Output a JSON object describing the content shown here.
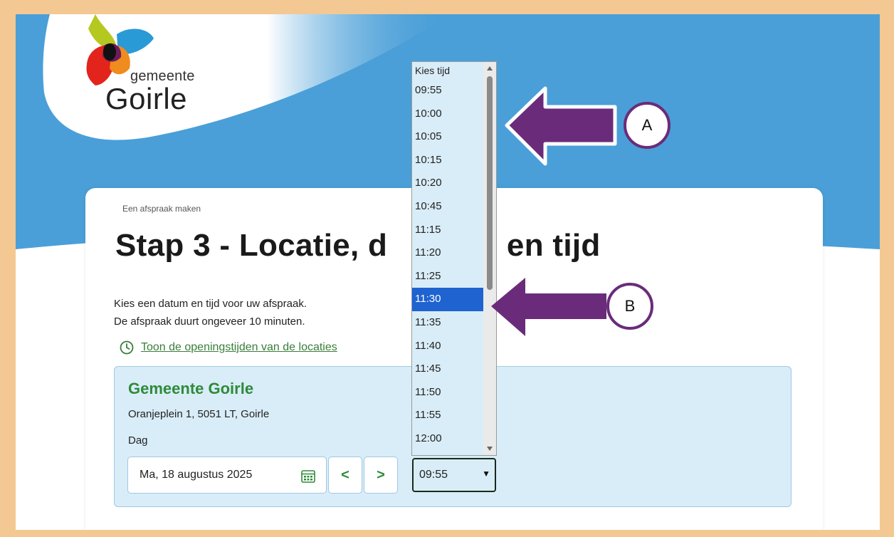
{
  "logo": {
    "small": "gemeente",
    "big": "Goirle"
  },
  "breadcrumb": "Een afspraak maken",
  "page_title": "Stap 3 - Locatie, d",
  "page_title_tail": "n en tijd",
  "intro": {
    "line1": "Kies een datum en tijd voor uw afspraak.",
    "line2": "De afspraak duurt ongeveer 10 minuten."
  },
  "hours_link": "Toon de openingstijden van de locaties",
  "location": {
    "name": "Gemeente Goirle",
    "address": "Oranjeplein 1, 5051 LT, Goirle",
    "day_label": "Dag",
    "date_value": "Ma, 18 augustus 2025",
    "prev_label": "<",
    "next_label": ">"
  },
  "time_select": {
    "value": "09:55"
  },
  "dropdown": {
    "placeholder": "Kies tijd",
    "options": [
      "09:55",
      "10:00",
      "10:05",
      "10:15",
      "10:20",
      "10:45",
      "11:15",
      "11:20",
      "11:25",
      "11:30",
      "11:35",
      "11:40",
      "11:45",
      "11:50",
      "11:55",
      "12:00"
    ],
    "selected": "11:30"
  },
  "annotations": {
    "a": "A",
    "b": "B"
  },
  "colors": {
    "brand_blue": "#4a9fd8",
    "accent_green": "#2f8a3a",
    "selected_blue": "#1e63d0",
    "arrow_purple": "#6a2c7a",
    "frame": "#f3c892"
  }
}
